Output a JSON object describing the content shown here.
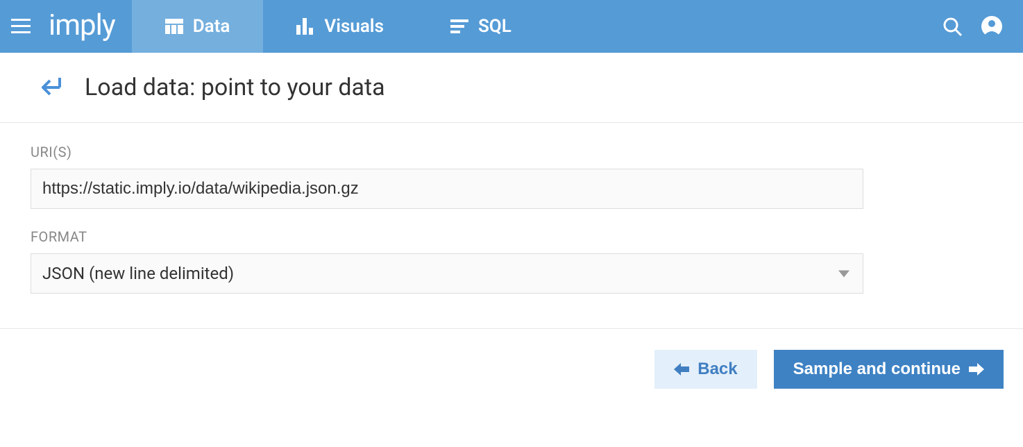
{
  "header": {
    "logo": "imply",
    "tabs": [
      {
        "label": "Data",
        "active": true
      },
      {
        "label": "Visuals",
        "active": false
      },
      {
        "label": "SQL",
        "active": false
      }
    ]
  },
  "page": {
    "title": "Load data: point to your data"
  },
  "form": {
    "uris": {
      "label": "URI(S)",
      "value": "https://static.imply.io/data/wikipedia.json.gz"
    },
    "format": {
      "label": "FORMAT",
      "value": "JSON (new line delimited)"
    }
  },
  "footer": {
    "back_label": "Back",
    "continue_label": "Sample and continue"
  }
}
